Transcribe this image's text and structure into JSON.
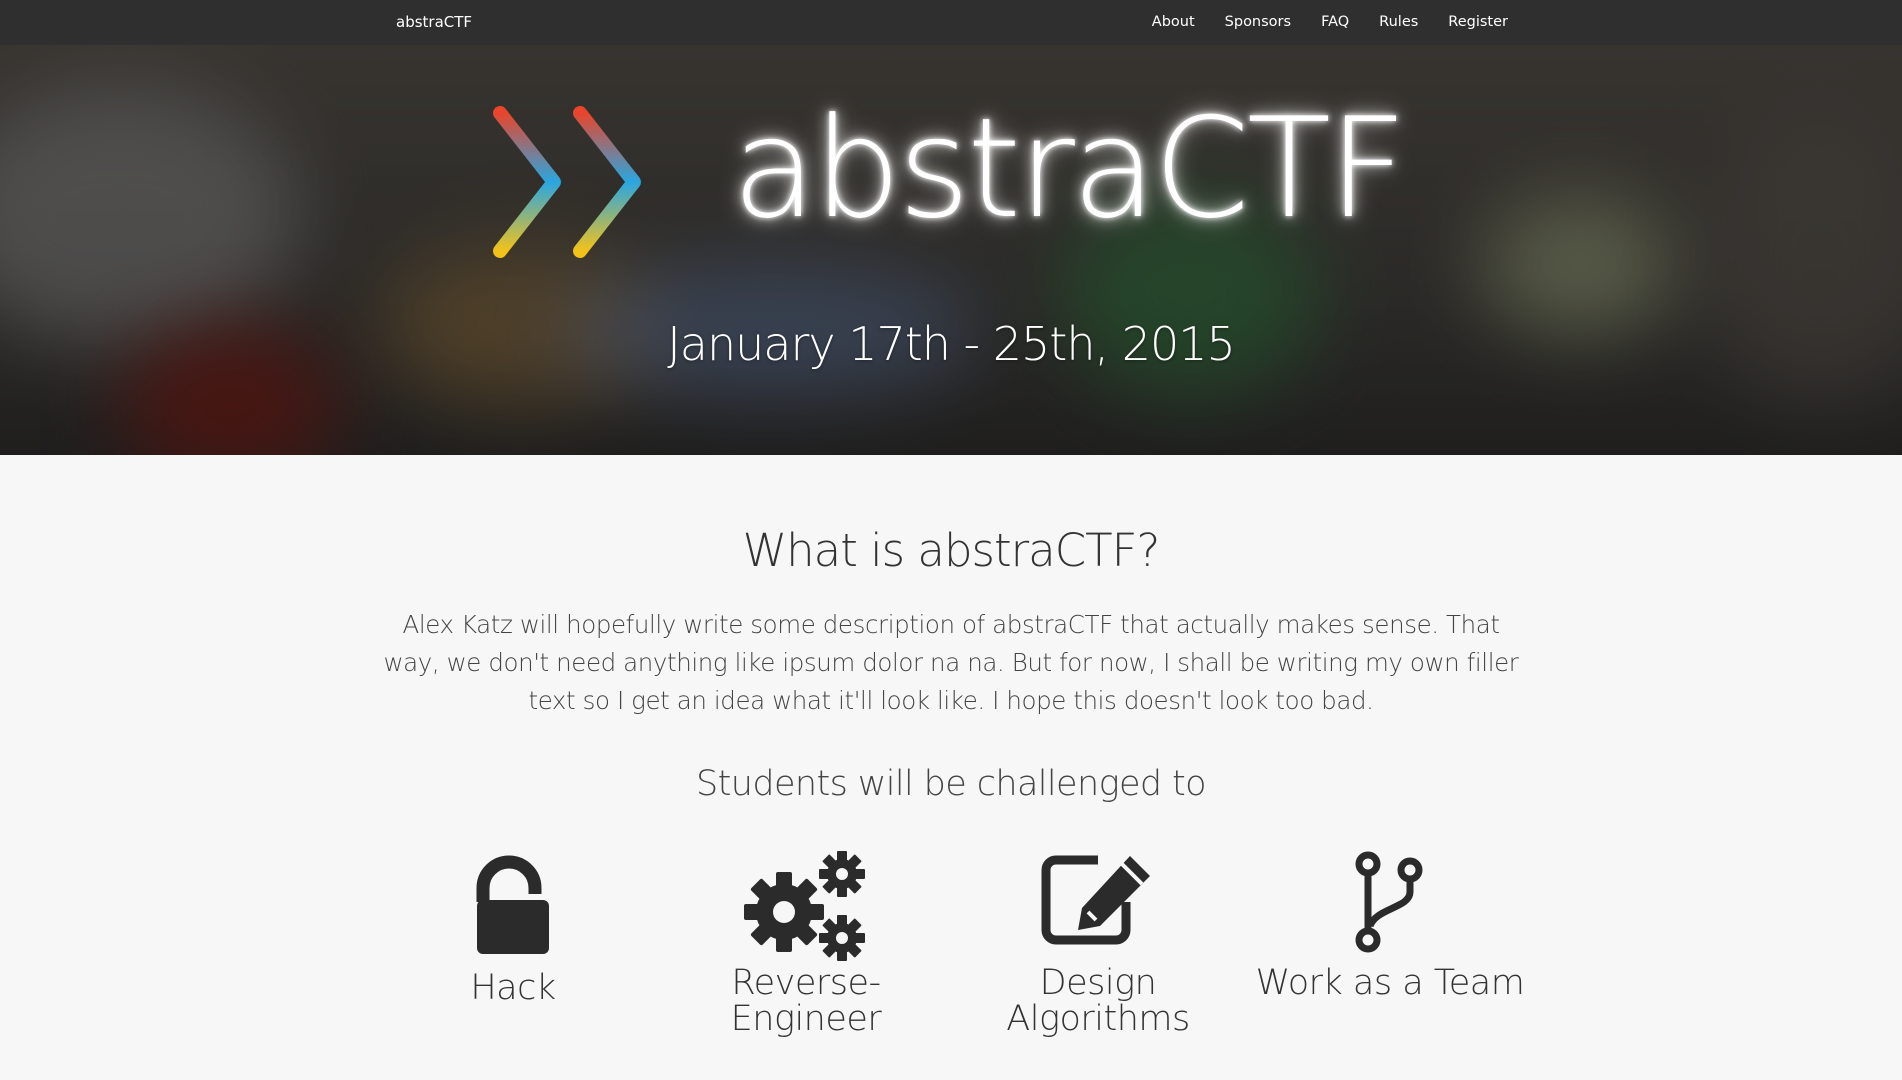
{
  "nav": {
    "brand": "abstraCTF",
    "links": [
      "About",
      "Sponsors",
      "FAQ",
      "Rules",
      "Register"
    ]
  },
  "hero": {
    "logo_text": "abstraCTF",
    "date": "January 17th - 25th, 2015"
  },
  "about": {
    "title": "What is abstraCTF?",
    "description": "Alex Katz will hopefully write some description of abstraCTF that actually makes sense. That way, we don't need anything like ipsum dolor na na. But for now, I shall be writing my own filler text so I get an idea what it'll look like. I hope this doesn't look too bad.",
    "challenge_heading": "Students will be challenged to"
  },
  "features": [
    {
      "icon": "unlock-icon",
      "label": "Hack"
    },
    {
      "icon": "gears-icon",
      "label": "Reverse-Engineer"
    },
    {
      "icon": "edit-icon",
      "label": "Design Algorithms"
    },
    {
      "icon": "code-fork-icon",
      "label": "Work as a Team"
    }
  ],
  "colors": {
    "navbar": "#2f2f2f",
    "background": "#f7f7f7",
    "text": "#333333",
    "logo_red": "#e8452c",
    "logo_blue": "#2aa6e0",
    "logo_yellow": "#f2c21b"
  }
}
